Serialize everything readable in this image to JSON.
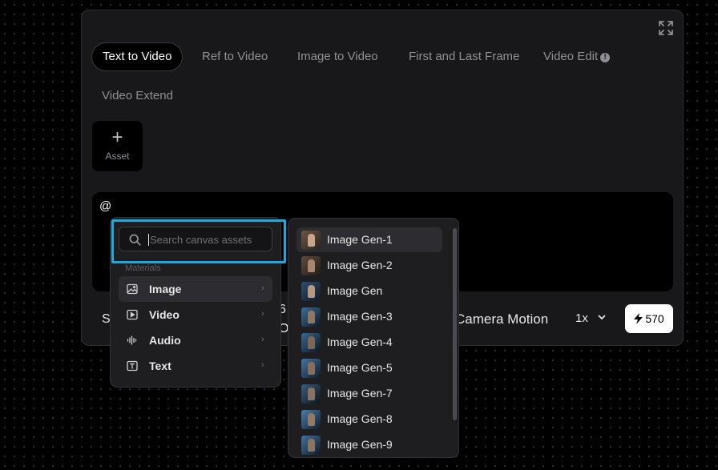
{
  "tabs": [
    {
      "label": "Text to Video",
      "active": true
    },
    {
      "label": "Ref to Video"
    },
    {
      "label": "Image to Video"
    },
    {
      "label": "First and Last Frame"
    },
    {
      "label": "Video Edit"
    },
    {
      "label": "Video Extend"
    }
  ],
  "asset_button": {
    "label": "Asset",
    "icon": "plus-icon"
  },
  "prompt": {
    "text": "@"
  },
  "bottom_bar": {
    "partial_left": "S",
    "partial_mid_top": "6",
    "partial_mid_bottom": "O",
    "camera_motion": "Camera Motion",
    "speed": "1x",
    "credits": "570"
  },
  "mention_menu": {
    "search_placeholder": "Search canvas assets",
    "section_label": "Materials",
    "items": [
      {
        "label": "Image",
        "icon": "image-icon"
      },
      {
        "label": "Video",
        "icon": "video-icon"
      },
      {
        "label": "Audio",
        "icon": "audio-icon"
      },
      {
        "label": "Text",
        "icon": "text-icon"
      }
    ]
  },
  "image_list": [
    "Image Gen-1",
    "Image Gen-2",
    "Image Gen",
    "Image Gen-3",
    "Image Gen-4",
    "Image Gen-5",
    "Image Gen-7",
    "Image Gen-8",
    "Image Gen-9"
  ],
  "colors": {
    "highlight": "#1ea7e1",
    "panel": "#18181b",
    "menu": "#1e1e21"
  }
}
